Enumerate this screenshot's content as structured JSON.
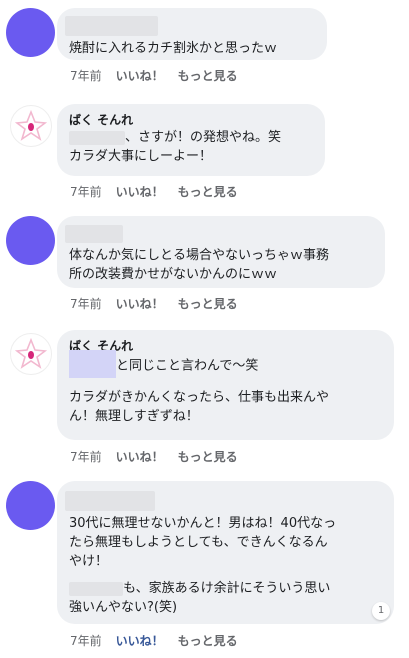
{
  "comments": [
    {
      "author": "",
      "lines": [
        "焼酎に入れるカチ割氷かと思ったｗ"
      ],
      "time": "7年前",
      "like": "いいね！",
      "more": "もっと見る"
    },
    {
      "author": "ばく そんれ",
      "line1_rest": "、さすが！の発想やね。笑",
      "line2": "カラダ大事にしーよー！",
      "time": "7年前",
      "like": "いいね！",
      "more": "もっと見る"
    },
    {
      "author": "",
      "lines": [
        "体なんか気にしとる場合やないっちゃｗ事務",
        "所の改装費かせがないかんのにｗｗ"
      ],
      "time": "7年前",
      "like": "いいね！",
      "more": "もっと見る"
    },
    {
      "author": "ばく そんれ",
      "line1_rest": "と同じこと言わんで〜笑",
      "line2": "カラダがきかんくなったら、仕事も出来んや",
      "line3": "ん！無理しすぎずね！",
      "time": "7年前",
      "like": "いいね！",
      "more": "もっと見る"
    },
    {
      "author": "",
      "lines": [
        "30代に無理せないかんと！男はね！40代なっ",
        "たら無理もしようとしても、できんくなるん",
        "やけ！"
      ],
      "line4_rest": "も、家族あるけ余計にそういう思い",
      "line5": "強いんやない?(笑)",
      "reply_count": "1",
      "time": "7年前",
      "like": "いいね！",
      "more": "もっと見る"
    }
  ],
  "colors": {
    "avatar": "#6a5af0",
    "bubble": "#eef0f3",
    "like_active": "#385898"
  }
}
